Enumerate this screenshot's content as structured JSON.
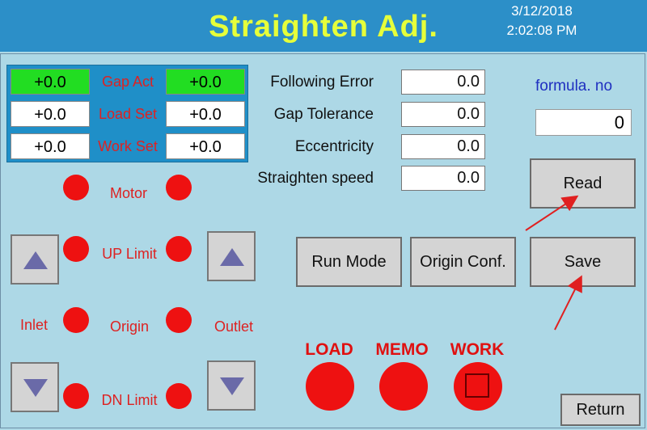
{
  "header": {
    "title": "Straighten Adj.",
    "date": "3/12/2018",
    "time": "2:02:08 PM"
  },
  "gap": {
    "rows": [
      {
        "label": "Gap Act",
        "left": "+0.0",
        "right": "+0.0"
      },
      {
        "label": "Load Set",
        "left": "+0.0",
        "right": "+0.0"
      },
      {
        "label": "Work Set",
        "left": "+0.0",
        "right": "+0.0"
      }
    ]
  },
  "fields": [
    {
      "label": "Following Error",
      "value": "0.0"
    },
    {
      "label": "Gap Tolerance",
      "value": "0.0"
    },
    {
      "label": "Eccentricity",
      "value": "0.0"
    },
    {
      "label": "Straighten speed",
      "value": "0.0"
    }
  ],
  "formula": {
    "label": "formula. no",
    "value": "0"
  },
  "buttons": {
    "read": "Read",
    "save": "Save",
    "run_mode": "Run Mode",
    "origin_conf": "Origin Conf.",
    "return": "Return"
  },
  "indicators": {
    "motor": "Motor",
    "up_limit": "UP Limit",
    "origin": "Origin",
    "dn_limit": "DN Limit",
    "inlet": "Inlet",
    "outlet": "Outlet"
  },
  "status": {
    "load": "LOAD",
    "memo": "MEMO",
    "work": "WORK"
  },
  "colors": {
    "background": "#add8e6",
    "header": "#2c8fc8",
    "title": "#e6ff3a",
    "indicator": "#ee1111",
    "active_cell": "#22dd22"
  }
}
